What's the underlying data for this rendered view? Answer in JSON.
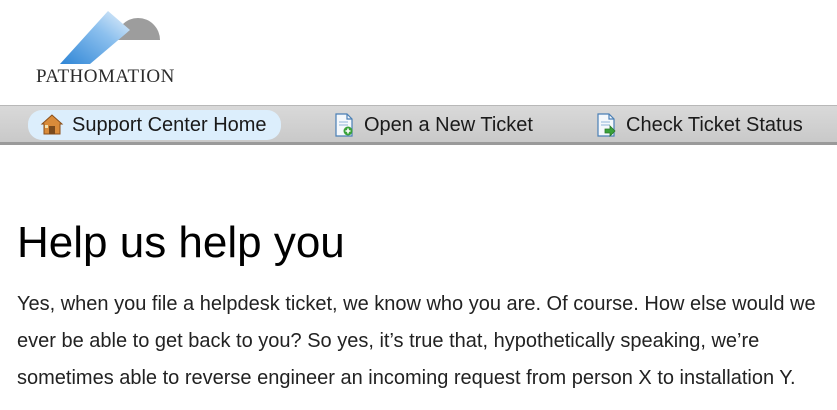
{
  "logo": {
    "text": "PATHOMATION",
    "icon": "pathomation-logo"
  },
  "nav": {
    "items": [
      {
        "label": "Support Center Home",
        "icon": "home-icon",
        "active": true
      },
      {
        "label": "Open a New Ticket",
        "icon": "new-ticket-icon",
        "active": false
      },
      {
        "label": "Check Ticket Status",
        "icon": "ticket-status-icon",
        "active": false
      }
    ]
  },
  "article": {
    "heading": "Help us help you",
    "body": "Yes, when you file a helpdesk ticket, we know who you are. Of course. How else would we ever be able to get back to you? So yes, it’s true that, hypothetically speaking, we’re sometimes able to reverse engineer an incoming request from person X to installation Y."
  },
  "colors": {
    "nav_bg": "#d0d0d0",
    "active_pill": "#dceefc",
    "logo_blue": "#3b8fd9"
  }
}
